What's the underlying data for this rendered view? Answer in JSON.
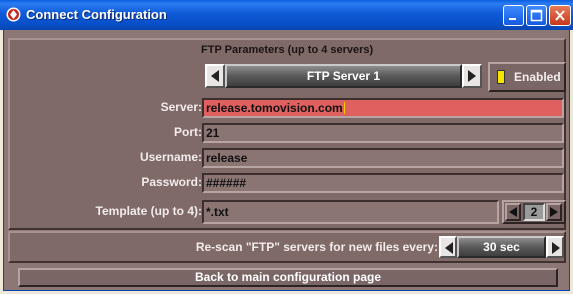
{
  "window": {
    "title": "Connect Configuration"
  },
  "ftp": {
    "section_title": "FTP Parameters (up to 4 servers)",
    "server_selector": "FTP Server 1",
    "enabled_label": "Enabled",
    "server_label": "Server:",
    "server_value": "release.tomovision.com",
    "port_label": "Port:",
    "port_value": "21",
    "username_label": "Username:",
    "username_value": "release",
    "password_label": "Password:",
    "password_value": "######",
    "template_label": "Template (up to 4):",
    "template_value": "*.txt",
    "template_index": "2"
  },
  "rescan": {
    "label": "Re-scan \"FTP\" servers for new files every:",
    "interval": "30 sec"
  },
  "footer": {
    "back_button": "Back to main configuration page"
  },
  "colors": {
    "titlebar": "#0a5fe0",
    "panel": "#7f6a68",
    "active_field": "#e06060",
    "caret": "#f0d000"
  }
}
